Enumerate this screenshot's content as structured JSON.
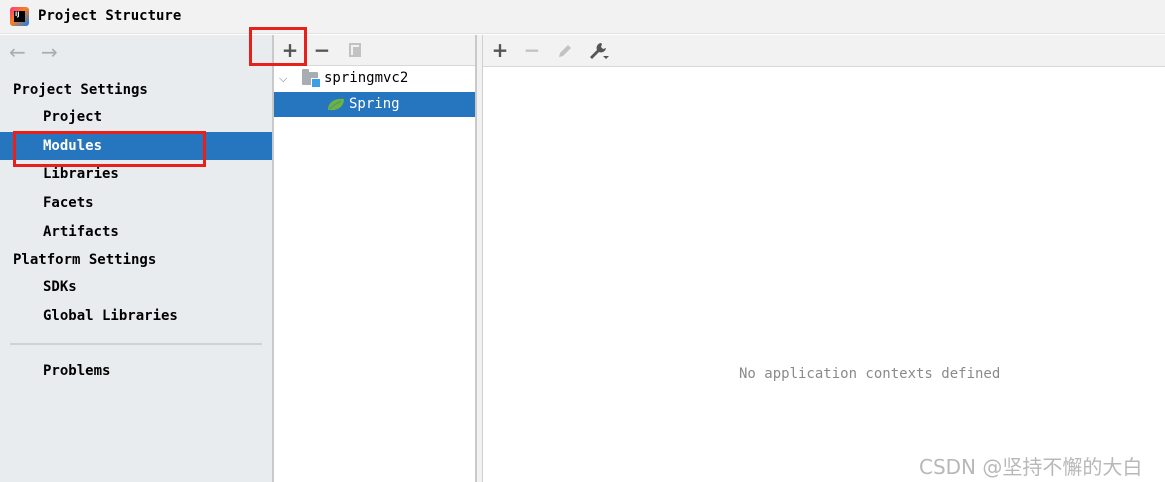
{
  "window": {
    "title": "Project Structure",
    "app_icon_text": "IJ"
  },
  "nav": {
    "back": "←",
    "forward": "→"
  },
  "sidebar": {
    "project_settings_header": "Project Settings",
    "project_items": [
      "Project",
      "Modules",
      "Libraries",
      "Facets",
      "Artifacts"
    ],
    "platform_settings_header": "Platform Settings",
    "platform_items": [
      "SDKs",
      "Global Libraries"
    ],
    "problems": "Problems",
    "selected": "Modules"
  },
  "modules_toolbar": {
    "add": "+",
    "remove": "−"
  },
  "tree": {
    "module_name": "springmvc2",
    "facet_name": "Spring",
    "chevron": "⌵"
  },
  "detail_toolbar": {
    "add": "+",
    "remove": "−"
  },
  "detail": {
    "empty_message": "No application contexts defined"
  },
  "watermark": "CSDN @坚持不懈的大白",
  "colors": {
    "selection": "#2675bf",
    "highlight_box": "#e8201c",
    "spring_leaf": "#6db33f"
  }
}
